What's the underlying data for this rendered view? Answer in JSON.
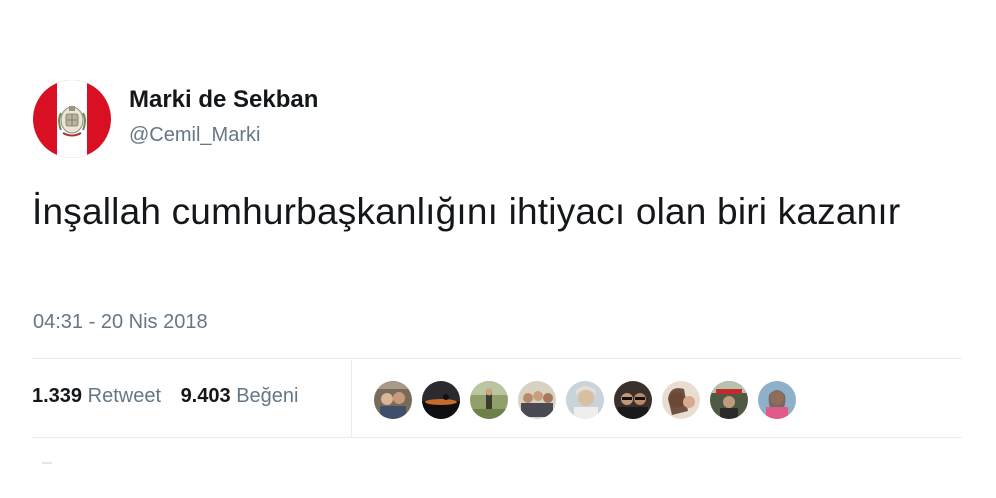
{
  "author": {
    "display_name": "Marki de Sekban",
    "handle": "@Cemil_Marki",
    "avatar_icon": "peru-flag-coat-of-arms-avatar",
    "avatar_colors": {
      "red": "#d91023",
      "white": "#ffffff"
    }
  },
  "tweet": {
    "text": "İnşallah cumhurbaşkanlığını ihtiyacı olan biri kazanır",
    "timestamp": "04:31 - 20 Nis 2018"
  },
  "stats": {
    "retweets_count": "1.339",
    "retweets_label": "Retweet",
    "likes_count": "9.403",
    "likes_label": "Beğeni"
  },
  "likers": [
    {
      "icon": "liker-avatar-1"
    },
    {
      "icon": "liker-avatar-2"
    },
    {
      "icon": "liker-avatar-3"
    },
    {
      "icon": "liker-avatar-4"
    },
    {
      "icon": "liker-avatar-5"
    },
    {
      "icon": "liker-avatar-6"
    },
    {
      "icon": "liker-avatar-7"
    },
    {
      "icon": "liker-avatar-8"
    },
    {
      "icon": "liker-avatar-9"
    }
  ],
  "colors": {
    "primary_text": "#14171a",
    "secondary_text": "#657786",
    "divider": "#e6ecf0"
  }
}
